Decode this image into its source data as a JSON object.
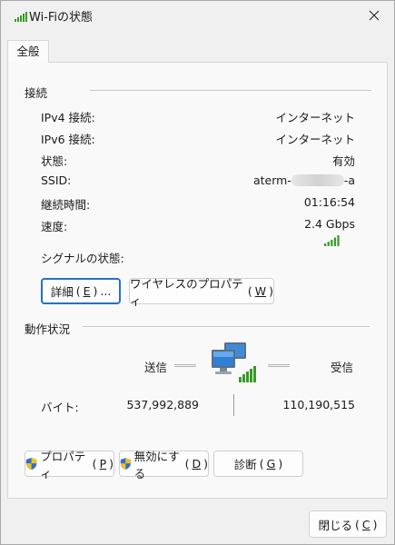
{
  "window": {
    "title": "Wi-Fiの状態",
    "close_label": "閉じる",
    "close_key": "C"
  },
  "tabs": [
    {
      "label": "全般"
    }
  ],
  "connection": {
    "section_title": "接続",
    "rows": [
      {
        "label": "IPv4 接続:",
        "value": "インターネット"
      },
      {
        "label": "IPv6 接続:",
        "value": "インターネット"
      },
      {
        "label": "状態:",
        "value": "有効"
      },
      {
        "label": "SSID:",
        "value_prefix": "aterm-",
        "value_suffix": "-a"
      },
      {
        "label": "継続時間:",
        "value": "01:16:54"
      },
      {
        "label": "速度:",
        "value": "2.4 Gbps"
      }
    ],
    "signal_label": "シグナルの状態:",
    "details_button": {
      "label": "詳細",
      "key": "E",
      "suffix": "..."
    },
    "wireless_button": {
      "label": "ワイヤレスのプロパティ",
      "key": "W"
    }
  },
  "activity": {
    "section_title": "動作状況",
    "sent_label": "送信",
    "received_label": "受信",
    "bytes_label": "バイト:",
    "sent_bytes": "537,992,889",
    "received_bytes": "110,190,515"
  },
  "buttons": {
    "properties": {
      "label": "プロパティ",
      "key": "P"
    },
    "disable": {
      "label": "無効にする",
      "key": "D"
    },
    "diagnose": {
      "label": "診断",
      "key": "G"
    }
  },
  "colors": {
    "signal_green": "#3a9a27",
    "focus_blue": "#2670c5"
  },
  "icons": [
    "wifi-signal-icon",
    "close-icon",
    "network-computers-icon",
    "shield-icon"
  ]
}
